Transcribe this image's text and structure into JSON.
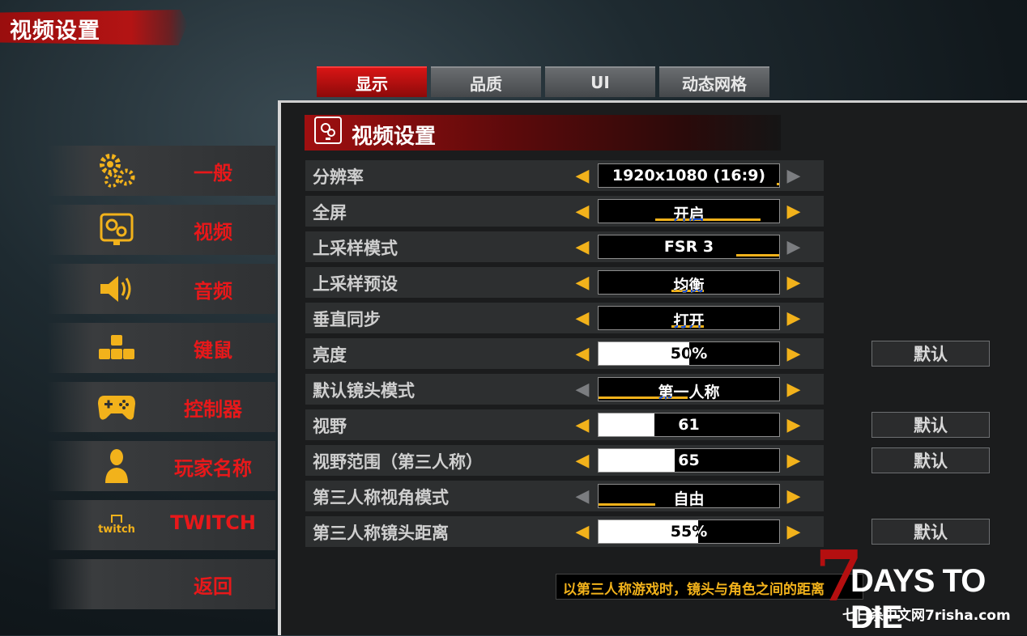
{
  "header": {
    "title": "视频设置"
  },
  "tabs": [
    {
      "label": "显示",
      "active": true
    },
    {
      "label": "品质",
      "active": false
    },
    {
      "label": "UI",
      "active": false
    },
    {
      "label": "动态网格",
      "active": false
    }
  ],
  "sidebar": {
    "items": [
      {
        "label": "一般",
        "icon": "gears-icon"
      },
      {
        "label": "视频",
        "icon": "monitor-gears-icon"
      },
      {
        "label": "音频",
        "icon": "speaker-icon"
      },
      {
        "label": "键鼠",
        "icon": "keyboard-keys-icon"
      },
      {
        "label": "控制器",
        "icon": "gamepad-icon"
      },
      {
        "label": "玩家名称",
        "icon": "person-icon"
      },
      {
        "label": "TWITCH",
        "icon": "twitch-icon",
        "icon_text": "twitch"
      },
      {
        "label": "返回",
        "icon": ""
      }
    ]
  },
  "panel": {
    "title": "视频设置"
  },
  "settings": [
    {
      "label": "分辨率",
      "value": "1920x1080 (16:9)",
      "left_enabled": true,
      "right_enabled": false
    },
    {
      "label": "全屏",
      "value": "开启",
      "left_enabled": true,
      "right_enabled": true
    },
    {
      "label": "上采样模式",
      "value": "FSR 3",
      "left_enabled": true,
      "right_enabled": false
    },
    {
      "label": "上采样预设",
      "value": "均衡",
      "left_enabled": true,
      "right_enabled": true
    },
    {
      "label": "垂直同步",
      "value": "打开",
      "left_enabled": true,
      "right_enabled": true
    },
    {
      "label": "亮度",
      "value": "50%",
      "level": 0.5,
      "left_enabled": true,
      "right_enabled": true,
      "default": "默认"
    },
    {
      "label": "默认镜头模式",
      "value": "第一人称",
      "left_enabled": false,
      "right_enabled": true
    },
    {
      "label": "视野",
      "value": "61",
      "level": 0.31,
      "left_enabled": true,
      "right_enabled": true,
      "default": "默认"
    },
    {
      "label": "视野范围（第三人称）",
      "value": "65",
      "level": 0.42,
      "left_enabled": true,
      "right_enabled": true,
      "default": "默认"
    },
    {
      "label": "第三人称视角模式",
      "value": "自由",
      "left_enabled": false,
      "right_enabled": true
    },
    {
      "label": "第三人称镜头距离",
      "value": "55%",
      "level": 0.55,
      "left_enabled": true,
      "right_enabled": true,
      "default": "默认"
    }
  ],
  "tooltip": {
    "text": "以第三人称游戏时，镜头与角色之间的距离"
  },
  "logo": {
    "seven": "7",
    "text": "DAYS TO DIE"
  },
  "watermark": {
    "text": "七日杀中文网7risha.com"
  },
  "colors": {
    "accent": "#f2b21b",
    "red": "#e8181a",
    "tab_active": "#d81515"
  }
}
